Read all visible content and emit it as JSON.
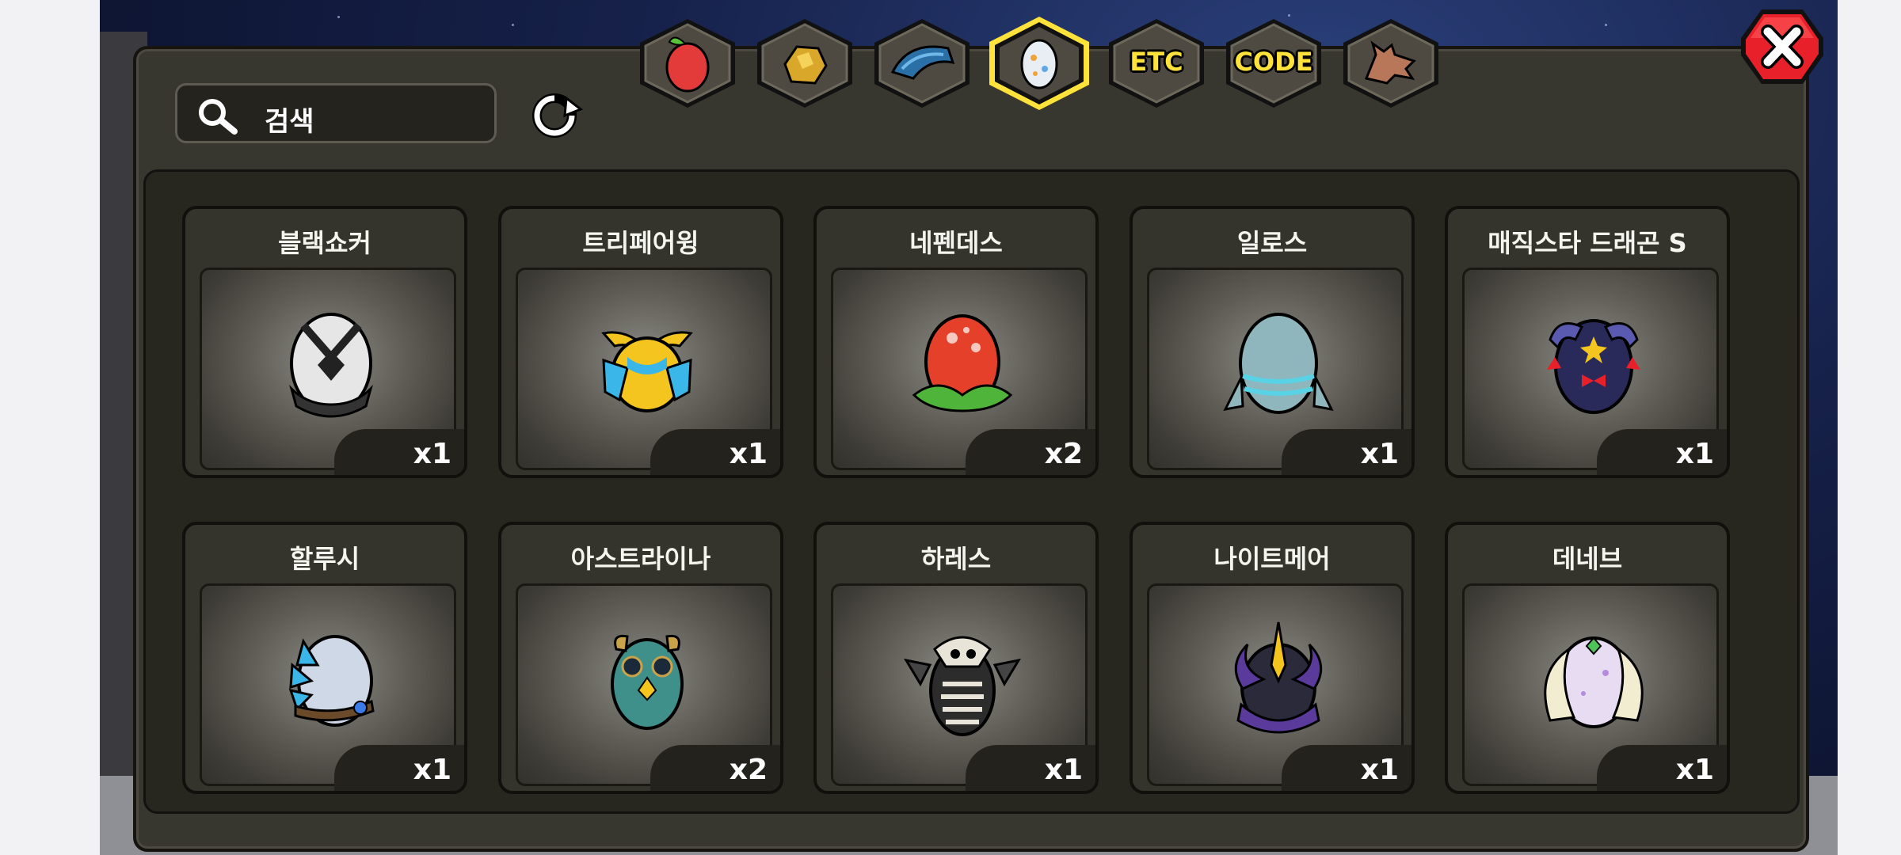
{
  "search": {
    "placeholder": "검색"
  },
  "tabs": [
    {
      "name": "fruit",
      "label": ""
    },
    {
      "name": "gold-ore",
      "label": ""
    },
    {
      "name": "dragon-scale",
      "label": ""
    },
    {
      "name": "egg",
      "label": "",
      "selected": true
    },
    {
      "name": "etc",
      "label": "ETC"
    },
    {
      "name": "code",
      "label": "CODE"
    },
    {
      "name": "dragon-head",
      "label": ""
    }
  ],
  "items": [
    {
      "name": "블랙쇼커",
      "qty": "x1",
      "icon": "black-shocker-egg-icon"
    },
    {
      "name": "트리페어윙",
      "qty": "x1",
      "icon": "tripair-wing-egg-icon"
    },
    {
      "name": "네펜데스",
      "qty": "x2",
      "icon": "nepenthes-egg-icon"
    },
    {
      "name": "일로스",
      "qty": "x1",
      "icon": "ilos-egg-icon"
    },
    {
      "name": "매직스타 드래곤 S",
      "qty": "x1",
      "icon": "magicstar-dragon-egg-icon"
    },
    {
      "name": "할루시",
      "qty": "x1",
      "icon": "halusi-egg-icon"
    },
    {
      "name": "아스트라이나",
      "qty": "x2",
      "icon": "astraina-egg-icon"
    },
    {
      "name": "하레스",
      "qty": "x1",
      "icon": "hares-egg-icon"
    },
    {
      "name": "나이트메어",
      "qty": "x1",
      "icon": "nightmare-egg-icon"
    },
    {
      "name": "데네브",
      "qty": "x1",
      "icon": "deneb-egg-icon"
    }
  ],
  "colors": {
    "accent": "#ffe23a",
    "close": "#e8202a",
    "panel": "#37362f"
  }
}
